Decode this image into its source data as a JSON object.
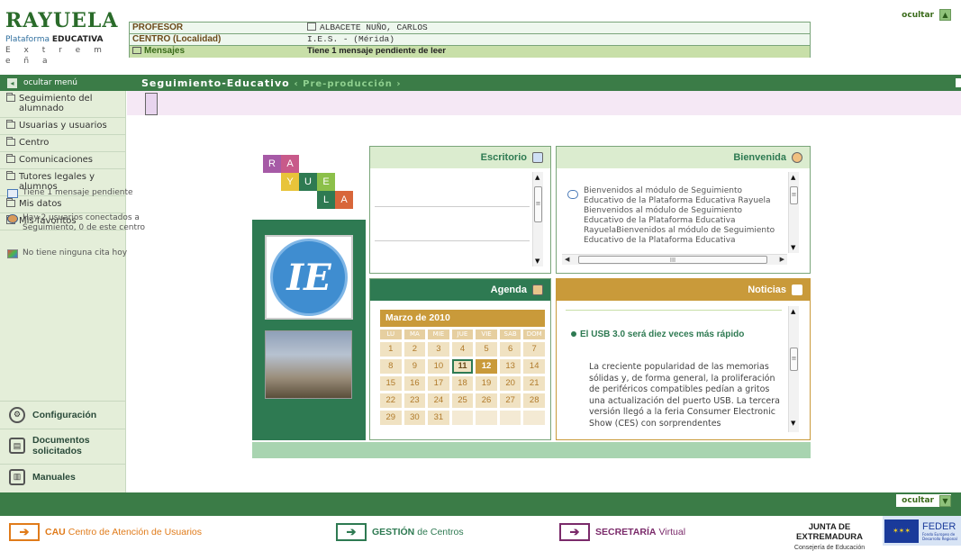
{
  "logo": {
    "letters": "RAYUELA",
    "line1": "Plataforma",
    "line1b": "EDUCATIVA",
    "line2": "E x t r e m e ñ a"
  },
  "user": {
    "rows": [
      {
        "label": "PROFESOR",
        "value": "ALBACETE NUÑO, CARLOS"
      },
      {
        "label": "CENTRO (Localidad)",
        "value": "I.E.S. -                  (Mérida)"
      },
      {
        "label": "Mensajes",
        "value": "Tiene 1 mensaje pendiente de leer"
      }
    ]
  },
  "top": {
    "hide_label": "ocultar",
    "hide_icon": "expand-up-icon"
  },
  "nav": {
    "hide_menu": "ocultar menú",
    "breadcrumb": "Seguimiento-Educativo",
    "env": "‹ Pre-producción ›"
  },
  "sidebar": {
    "items": [
      {
        "label": "Seguimiento del alumnado"
      },
      {
        "label": "Usuarias y usuarios"
      },
      {
        "label": "Centro"
      },
      {
        "label": "Comunicaciones"
      },
      {
        "label": "Tutores legales y alumnos"
      },
      {
        "label": "Mis datos"
      },
      {
        "label": "Mis favoritos"
      }
    ],
    "bottom": [
      {
        "label": "Configuración",
        "icon": "gears-icon"
      },
      {
        "label": "Documentos solicitados",
        "icon": "documents-icon"
      },
      {
        "label": "Manuales",
        "icon": "manuals-icon"
      }
    ]
  },
  "tiles": [
    "R",
    "A",
    "Y",
    "U",
    "E",
    "L",
    "A"
  ],
  "escritorio": {
    "title": "Escritorio",
    "items": [
      "Tiene 1 mensaje pendiente",
      "Hay 2 usuarios conectados a Seguimiento, 0 de este centro",
      "No tiene ninguna cita hoy"
    ]
  },
  "bienvenida": {
    "title": "Bienvenida",
    "text": "Bienvenidos al módulo de Seguimiento Educativo de la Plataforma Educativa Rayuela Bienvenidos al módulo de Seguimiento Educativo de la Plataforma Educativa RayuelaBienvenidos al módulo de Seguimiento Educativo de la Plataforma Educativa",
    "hscroll_thumb": "III"
  },
  "agenda": {
    "title": "Agenda",
    "month": "Marzo de 2010",
    "dow": [
      "LU",
      "MA",
      "MIE",
      "JUE",
      "VIE",
      "SAB",
      "DOM"
    ],
    "days": [
      "1",
      "2",
      "3",
      "4",
      "5",
      "6",
      "7",
      "8",
      "9",
      "10",
      "11",
      "12",
      "13",
      "14",
      "15",
      "16",
      "17",
      "18",
      "19",
      "20",
      "21",
      "22",
      "23",
      "24",
      "25",
      "26",
      "27",
      "28",
      "29",
      "30",
      "31",
      "",
      "",
      "",
      ""
    ],
    "selected": "11",
    "today": "12"
  },
  "noticias": {
    "title": "Noticias",
    "headline": "El USB 3.0 será diez veces más rápido",
    "body": "La creciente popularidad de las memorias sólidas y, de forma general, la proliferación de periféricos compatibles pedían a gritos una actualización del puerto USB. La tercera versión llegó a la feria Consumer Electronic Show (CES) con sorprendentes"
  },
  "bottom": {
    "hide_label": "ocultar",
    "hide_icon": "expand-down-icon"
  },
  "footer": {
    "cau_strong": "CAU",
    "cau_rest": "Centro de Atención de Usuarios",
    "gestion_strong": "GESTIÓN",
    "gestion_rest": "de Centros",
    "secretaria_strong": "SECRETARÍA",
    "secretaria_rest": "Virtual",
    "junta": "JUNTA DE EXTREMADURA",
    "consejeria": "Consejería de Educación",
    "feder": "FEDER",
    "feder_sub": "Fondo Europeo de Desarrollo Regional",
    "colors": {
      "cau": "#e07b1a",
      "gestion": "#2e7a52",
      "secretaria": "#7a2a6a"
    }
  }
}
